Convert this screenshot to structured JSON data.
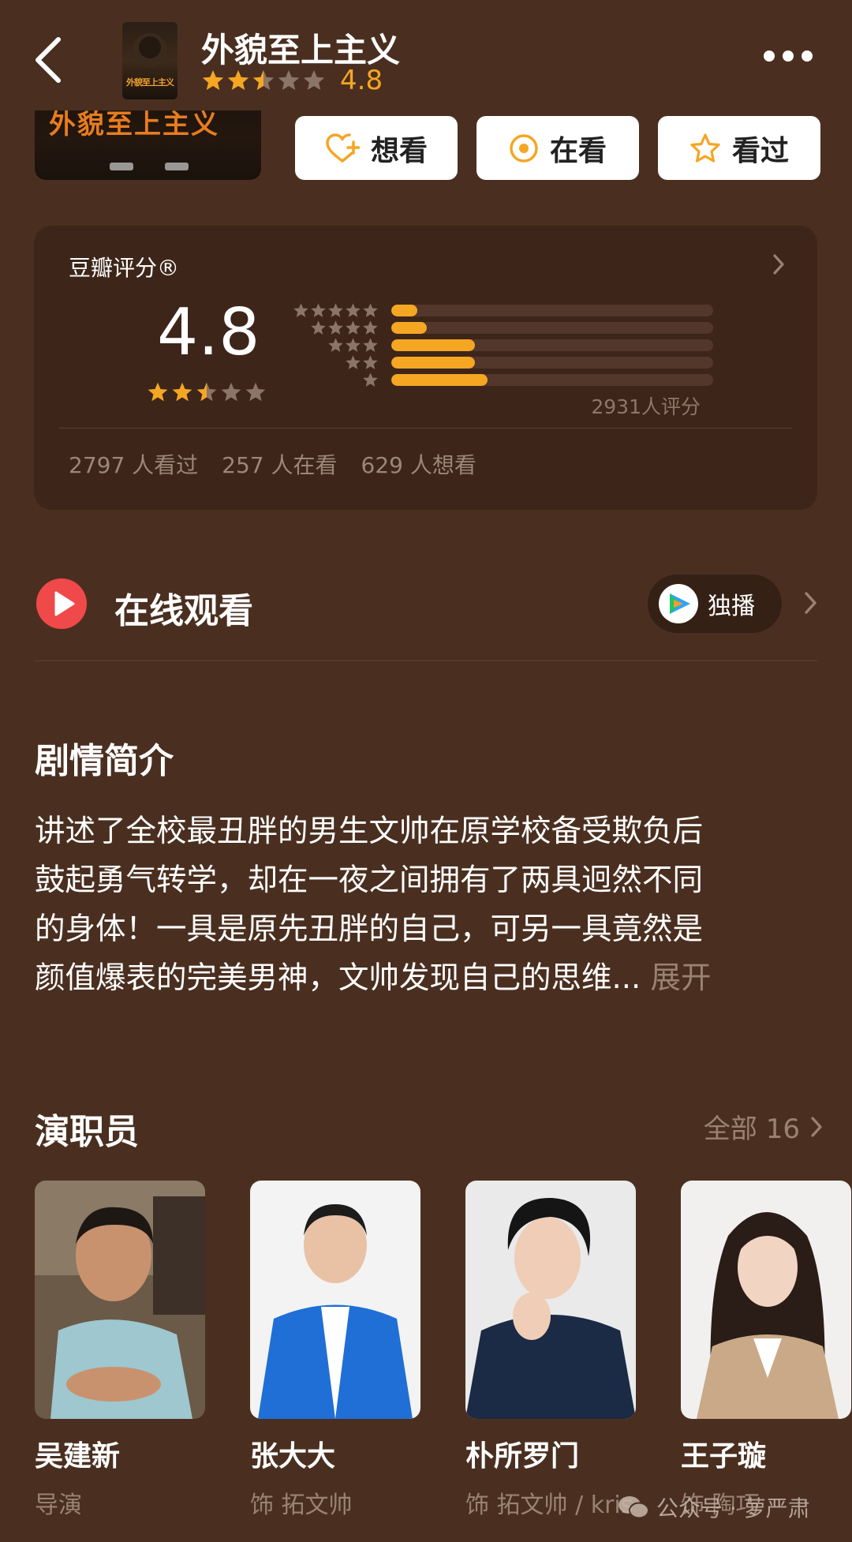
{
  "header": {
    "title": "外貌至上主义",
    "score": "4.8",
    "stars": [
      1,
      1,
      0.5,
      0,
      0
    ],
    "poster_text": "外貌至上主义"
  },
  "poster_strip": {
    "title": "外貌至上主义"
  },
  "actions": [
    {
      "label": "想看",
      "icon": "heart-plus-icon"
    },
    {
      "label": "在看",
      "icon": "target-icon"
    },
    {
      "label": "看过",
      "icon": "star-outline-icon"
    }
  ],
  "rating": {
    "label": "豆瓣评分®",
    "score": "4.8",
    "stars": [
      1,
      1,
      0.5,
      0,
      0
    ],
    "distribution": [
      {
        "stars": 5,
        "fraction": 0.08
      },
      {
        "stars": 4,
        "fraction": 0.11
      },
      {
        "stars": 3,
        "fraction": 0.26
      },
      {
        "stars": 2,
        "fraction": 0.26
      },
      {
        "stars": 1,
        "fraction": 0.3
      }
    ],
    "count_text": "2931人评分",
    "stats": [
      "2797 人看过",
      "257 人在看",
      "629 人想看"
    ]
  },
  "watch": {
    "title": "在线观看",
    "badge": "独播"
  },
  "synopsis": {
    "title": "剧情简介",
    "lines": [
      "讲述了全校最丑胖的男生文帅在原学校备受欺负后",
      "鼓起勇气转学，却在一夜之间拥有了两具迥然不同",
      "的身体！一具是原先丑胖的自己，可另一具竟然是",
      "颜值爆表的完美男神，文帅发现自己的思维..."
    ],
    "expand": "展开"
  },
  "cast": {
    "title": "演职员",
    "all_label": "全部 16",
    "members": [
      {
        "name": "吴建新",
        "role": "导演"
      },
      {
        "name": "张大大",
        "role": "饰 拓文帅"
      },
      {
        "name": "朴所罗门",
        "role": "饰 拓文帅 / kris"
      },
      {
        "name": "王子璇",
        "role": "饰 陶巧"
      }
    ]
  },
  "watermark": "公众号 · 萝严肃",
  "colors": {
    "background": "#4a2f20",
    "card": "#3d2619",
    "accent": "#f5a623",
    "muted": "#9a8272",
    "watch_icon": "#f0494a"
  }
}
